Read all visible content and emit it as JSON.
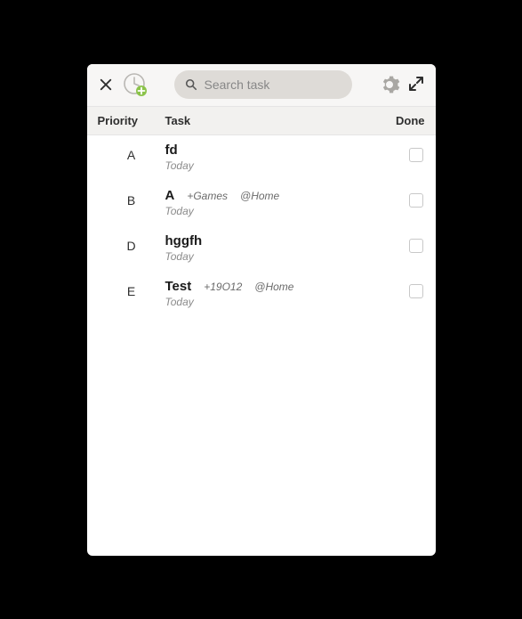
{
  "search": {
    "placeholder": "Search task"
  },
  "headers": {
    "priority": "Priority",
    "task": "Task",
    "done": "Done"
  },
  "tasks": [
    {
      "priority": "A",
      "title": "fd",
      "project": "",
      "context": "",
      "date": "Today"
    },
    {
      "priority": "B",
      "title": "A",
      "project": "+Games",
      "context": "@Home",
      "date": "Today"
    },
    {
      "priority": "D",
      "title": "hggfh",
      "project": "",
      "context": "",
      "date": "Today"
    },
    {
      "priority": "E",
      "title": "Test",
      "project": "+19O12",
      "context": "@Home",
      "date": "Today"
    }
  ]
}
